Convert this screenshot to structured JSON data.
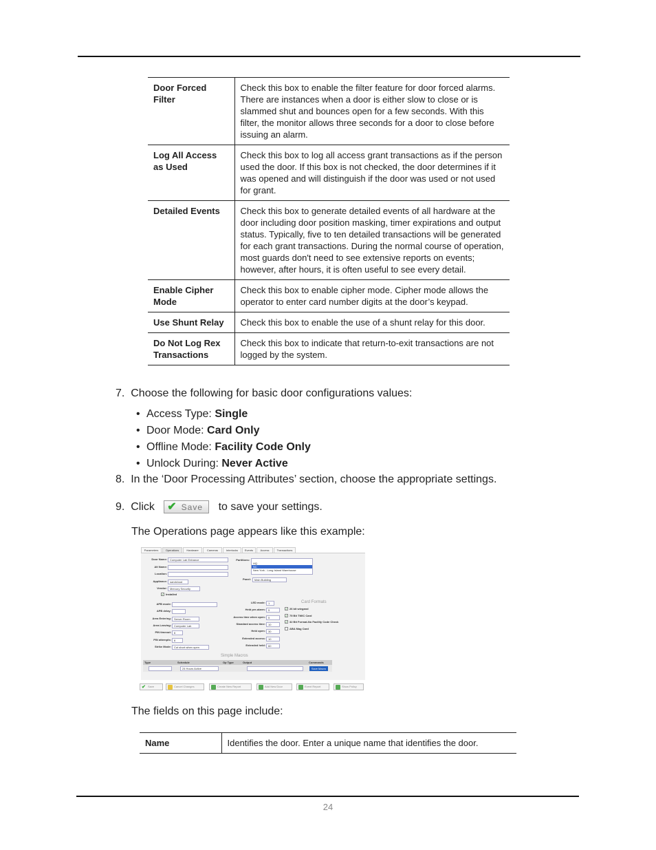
{
  "table1": [
    {
      "name": "Door Forced Filter",
      "desc": "Check this box to enable the filter feature for door forced alarms. There are instances when a door is either slow to close or is slammed shut and bounces open for a few seconds. With this filter, the monitor allows three seconds for a door to close before issuing an alarm."
    },
    {
      "name": "Log All Access as Used",
      "desc": "Check this box to log all access grant transactions as if the person used the door. If this box is not checked, the door determines if it was opened and will distinguish if the door was used or not used for grant."
    },
    {
      "name": "Detailed Events",
      "desc": "Check this box to generate detailed events of all hardware at the door including door position masking, timer expirations and output status. Typically, five to ten detailed transactions will be generated for each grant transactions. During the normal course of operation, most guards don't need to see extensive reports on events; however, after hours, it is often useful to see every detail."
    },
    {
      "name": "Enable Cipher Mode",
      "desc": "Check this box to enable cipher mode. Cipher mode allows the operator to enter card number digits at the door’s keypad."
    },
    {
      "name": "Use Shunt Relay",
      "desc": "Check this box to enable the use of a shunt relay for this door."
    },
    {
      "name": "Do Not Log Rex Transactions",
      "desc": "Check this box to indicate that return-to-exit transactions are not logged by the system."
    }
  ],
  "step7": {
    "num": "7.",
    "text": "Choose the following for basic door configurations values:",
    "bullets": [
      {
        "label": "Access Type: ",
        "value": "Single"
      },
      {
        "label": "Door Mode: ",
        "value": "Card Only"
      },
      {
        "label": "Offline Mode: ",
        "value": "Facility Code Only"
      },
      {
        "label": "Unlock During: ",
        "value": "Never Active"
      }
    ]
  },
  "step8": {
    "num": "8.",
    "text": "In the ‘Door Processing Attributes’ section, choose the appropriate settings."
  },
  "step9": {
    "num": "9.",
    "pre": "Click",
    "button": "Save",
    "post": "to save your settings."
  },
  "example_text": "The Operations page appears like this example:",
  "shot": {
    "tabs": [
      "Parameters",
      "Operations",
      "Hardware",
      "Cameras",
      "Interlocks",
      "Events",
      "Access",
      "Transactions"
    ],
    "door_name_label": "Door Name:",
    "door_name": "Computer Lab Entrance",
    "alt_name_label": "Alt Name:",
    "location_label": "Location:",
    "appliance_label": "Appliance:",
    "appliance": "sandcloud",
    "vendor_label": "Vendor:",
    "vendor": "Mercury Security",
    "installed": "Installed",
    "partitions_label": "Partitions:",
    "partitions": [
      "HQ",
      "NC",
      "New York - Long Island Warehouse"
    ],
    "panel_label": "Panel:",
    "panel": "Main Building",
    "left_fields": [
      {
        "l": "APB mode:",
        "v": ""
      },
      {
        "l": "APB delay:",
        "v": ""
      },
      {
        "l": "Area Entering:",
        "v": "Server Room"
      },
      {
        "l": "Area Leaving:",
        "v": "Computer Lab"
      },
      {
        "l": "PIN timeout:",
        "v": "6"
      },
      {
        "l": "PIN attempts:",
        "v": "6"
      },
      {
        "l": "Strike Mode:",
        "v": "Cut short when open"
      }
    ],
    "mid_fields": [
      {
        "l": "LED mode:",
        "v": "1"
      },
      {
        "l": "Held pre-alarm:",
        "v": "5"
      },
      {
        "l": "Access time when open:",
        "v": "5"
      },
      {
        "l": "Standard access time:",
        "v": "10"
      },
      {
        "l": "Held open:",
        "v": "30"
      },
      {
        "l": "Extended access:",
        "v": "10"
      },
      {
        "l": "Extended held:",
        "v": "60"
      }
    ],
    "card_formats_title": "Card Formats",
    "card_formats": [
      {
        "l": "26 bit wiegand",
        "checked": true
      },
      {
        "l": "75 Bit TWIC Card",
        "checked": true
      },
      {
        "l": "32 Bit Format-No Facility Code Check",
        "checked": true
      },
      {
        "l": "ABA Mag Card",
        "checked": false
      }
    ],
    "macros_title": "Simple Macros",
    "macro_headers": [
      "Type",
      "Schedule",
      "Op Type",
      "Output",
      "Commands"
    ],
    "macro_schedule": "24 Hours Active",
    "save_macro": "Save Macro",
    "buttons": [
      "Save",
      "Cancel Changes",
      "Create New Report",
      "Add New Door",
      "Event Report",
      "Show Policy"
    ]
  },
  "fields_text": "The fields on this page include:",
  "fields": [
    {
      "name": "Name",
      "desc": "Identifies the door.  Enter a unique name that identifies the door."
    }
  ],
  "page_number": "24"
}
